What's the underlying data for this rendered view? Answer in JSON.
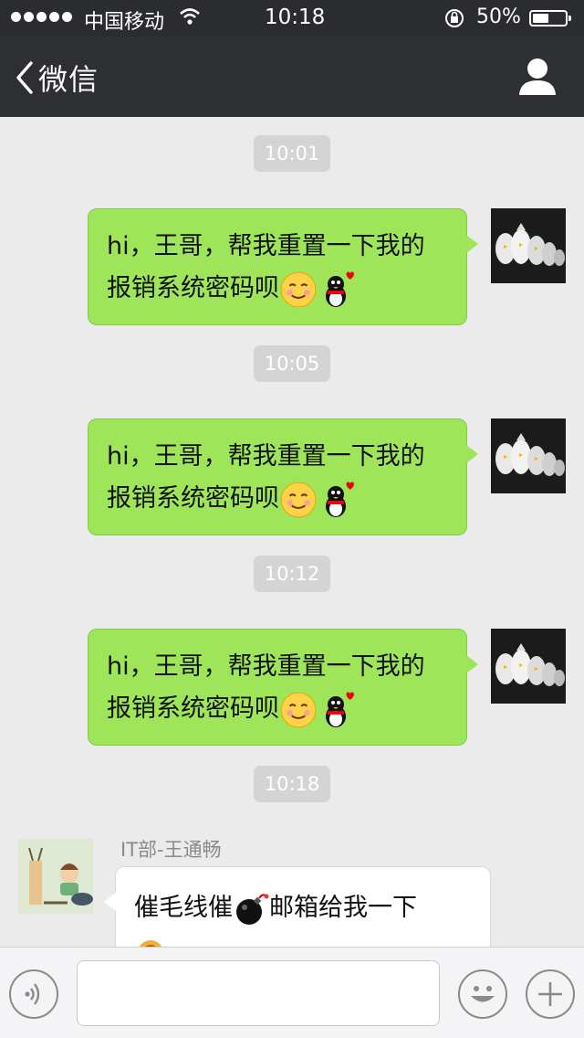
{
  "status_bar": {
    "carrier": "中国移动",
    "time": "10:18",
    "battery": "50%",
    "battery_level": 0.5
  },
  "nav": {
    "back_label": "微信"
  },
  "messages": [
    {
      "time": "10:01",
      "text1": "hi，王哥，帮我重置一下我的",
      "text2": "报销系统密码呗"
    },
    {
      "time": "10:05",
      "text1": "hi，王哥，帮我重置一下我的",
      "text2": "报销系统密码呗"
    },
    {
      "time": "10:12",
      "text1": "hi，王哥，帮我重置一下我的",
      "text2": "报销系统密码呗"
    }
  ],
  "last_time": "10:18",
  "reply": {
    "sender": "IT部-王通畅",
    "text_a": "催毛线催",
    "text_b": "邮箱给我一下"
  },
  "colors": {
    "bubble_out": "#9ee55a",
    "navbar": "#2e2f33",
    "background": "#ebebeb"
  }
}
